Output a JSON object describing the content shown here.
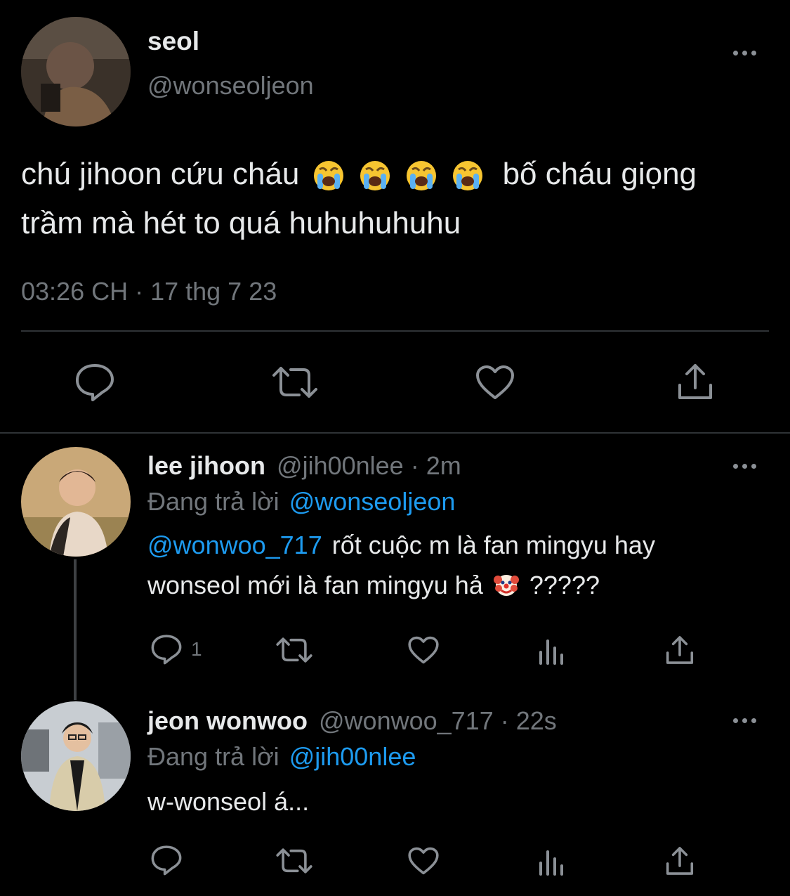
{
  "main_tweet": {
    "display_name": "seol",
    "handle": "@wonseoljeon",
    "text_part1": "chú jihoon cứu cháu",
    "text_part2": "bố cháu giọng",
    "text_line2": "trầm mà hét to quá huhuhuhuhu",
    "timestamp": "03:26 CH · 17 thg 7 23",
    "emoji_1": "loudly-crying-face",
    "emoji_count": 4
  },
  "reply1": {
    "display_name": "lee jihoon",
    "meta": "@jih00nlee · 2m",
    "replying_prefix": "Đang trả lời",
    "replying_to": "@wonseoljeon",
    "mention": "@wonwoo_717",
    "text_line1_rest": "rốt cuộc m là fan mingyu hay",
    "text_line2": "wonseol mới là fan mingyu hả",
    "text_line2_suffix": "?????",
    "emoji": "clown-face",
    "reply_count": "1"
  },
  "reply2": {
    "display_name": "jeon wonwoo",
    "meta": "@wonwoo_717 · 22s",
    "replying_prefix": "Đang trả lời",
    "replying_to": "@jih00nlee",
    "text": "w-wonseol á..."
  },
  "colors": {
    "background": "#000000",
    "text": "#e7e9ea",
    "muted": "#71767b",
    "link": "#1d9bf0",
    "divider": "#2f3336"
  }
}
